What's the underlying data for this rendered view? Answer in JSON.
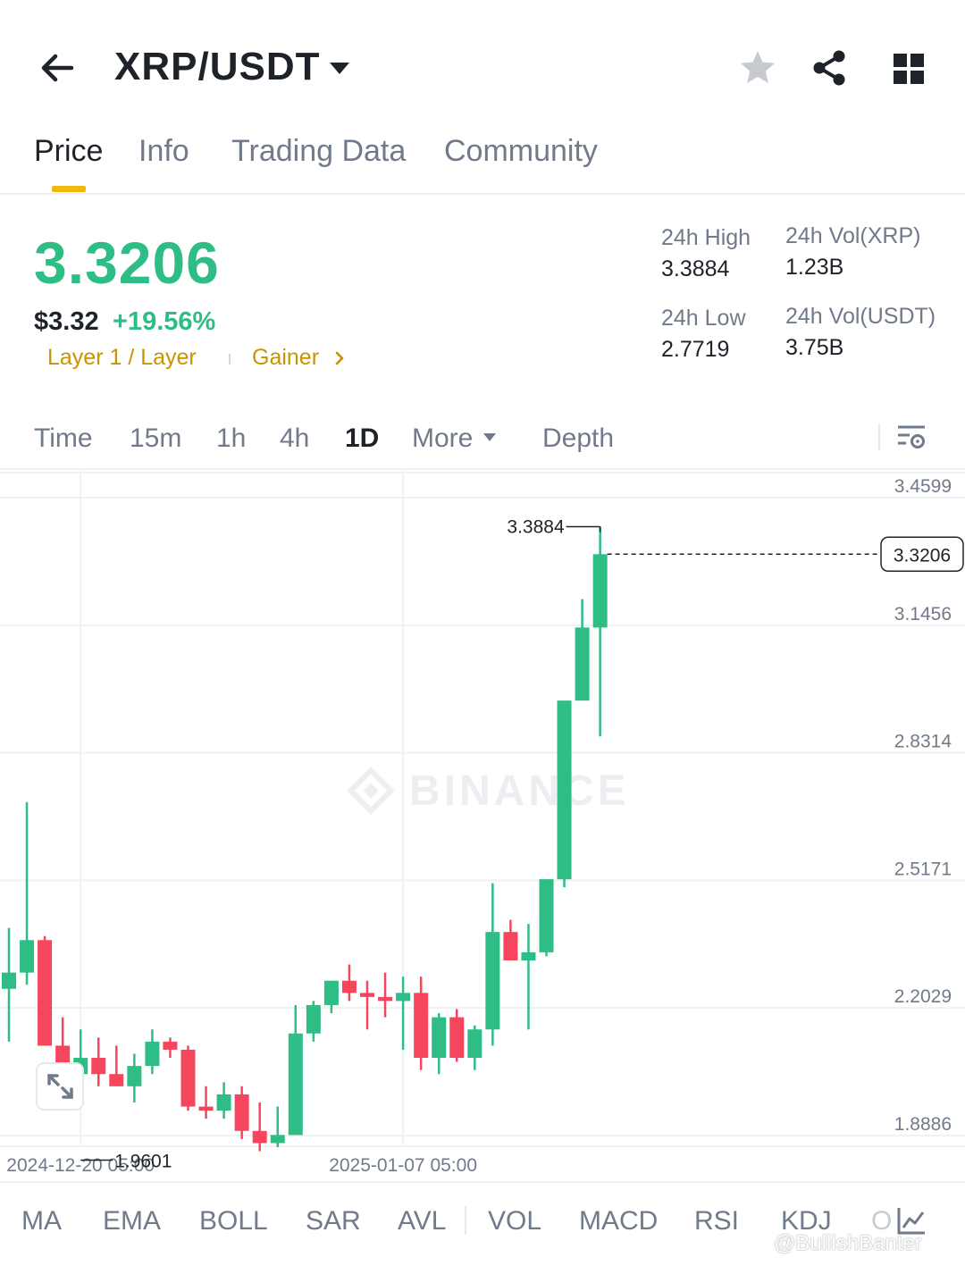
{
  "header": {
    "pair": "XRP/USDT",
    "icons": [
      "back-arrow-icon",
      "caret-down-icon",
      "star-icon",
      "share-icon",
      "grid-icon"
    ]
  },
  "tabs": [
    {
      "label": "Price",
      "active": true
    },
    {
      "label": "Info",
      "active": false
    },
    {
      "label": "Trading Data",
      "active": false
    },
    {
      "label": "Community",
      "active": false
    }
  ],
  "ticker": {
    "last_price": "3.3206",
    "usd_price": "$3.32",
    "change_pct": "+19.56%",
    "tag_category": "Layer 1 / Layer",
    "tag_gainer": "Gainer",
    "high_label": "24h High",
    "high_value": "3.3884",
    "low_label": "24h Low",
    "low_value": "2.7719",
    "vol_base_label": "24h Vol(XRP)",
    "vol_base_value": "1.23B",
    "vol_quote_label": "24h Vol(USDT)",
    "vol_quote_value": "3.75B"
  },
  "intervals": [
    {
      "label": "Time",
      "active": false
    },
    {
      "label": "15m",
      "active": false
    },
    {
      "label": "1h",
      "active": false
    },
    {
      "label": "4h",
      "active": false
    },
    {
      "label": "1D",
      "active": true
    },
    {
      "label": "More",
      "active": false
    },
    {
      "label": "Depth",
      "active": false
    }
  ],
  "chart_data": {
    "type": "candlestick",
    "ylim": [
      1.8886,
      3.4599
    ],
    "y_ticks": [
      "3.4599",
      "3.1456",
      "2.8314",
      "2.5171",
      "2.2029",
      "1.8886"
    ],
    "x_ticks": [
      "2024-12-20 05:00",
      "2025-01-07 05:00"
    ],
    "current_price_label": "3.3206",
    "high_marker": "3.3884",
    "low_marker": "1.9601",
    "watermark": "BINANCE",
    "colors": {
      "up": "#2ebd85",
      "down": "#f6465d",
      "grid": "#f0f1f2"
    },
    "candles": [
      {
        "o": 2.25,
        "h": 2.4,
        "l": 2.12,
        "c": 2.29
      },
      {
        "o": 2.29,
        "h": 2.71,
        "l": 2.26,
        "c": 2.37
      },
      {
        "o": 2.37,
        "h": 2.38,
        "l": 2.24,
        "c": 2.11
      },
      {
        "o": 2.11,
        "h": 2.18,
        "l": 2.01,
        "c": 2.04
      },
      {
        "o": 2.04,
        "h": 2.15,
        "l": 1.9601,
        "c": 2.08
      },
      {
        "o": 2.08,
        "h": 2.13,
        "l": 2.01,
        "c": 2.04
      },
      {
        "o": 2.04,
        "h": 2.11,
        "l": 2.01,
        "c": 2.01
      },
      {
        "o": 2.01,
        "h": 2.09,
        "l": 1.97,
        "c": 2.06
      },
      {
        "o": 2.06,
        "h": 2.15,
        "l": 2.04,
        "c": 2.12
      },
      {
        "o": 2.12,
        "h": 2.13,
        "l": 2.08,
        "c": 2.1
      },
      {
        "o": 2.1,
        "h": 2.11,
        "l": 1.95,
        "c": 1.96
      },
      {
        "o": 1.96,
        "h": 2.01,
        "l": 1.93,
        "c": 1.95
      },
      {
        "o": 1.95,
        "h": 2.02,
        "l": 1.93,
        "c": 1.99
      },
      {
        "o": 1.99,
        "h": 2.01,
        "l": 1.88,
        "c": 1.9
      },
      {
        "o": 1.9,
        "h": 1.97,
        "l": 1.85,
        "c": 1.87
      },
      {
        "o": 1.87,
        "h": 1.96,
        "l": 1.86,
        "c": 1.89
      },
      {
        "o": 1.89,
        "h": 2.21,
        "l": 1.89,
        "c": 2.14
      },
      {
        "o": 2.14,
        "h": 2.22,
        "l": 2.12,
        "c": 2.21
      },
      {
        "o": 2.21,
        "h": 2.27,
        "l": 2.19,
        "c": 2.27
      },
      {
        "o": 2.27,
        "h": 2.31,
        "l": 2.22,
        "c": 2.24
      },
      {
        "o": 2.24,
        "h": 2.27,
        "l": 2.15,
        "c": 2.23
      },
      {
        "o": 2.23,
        "h": 2.29,
        "l": 2.18,
        "c": 2.22
      },
      {
        "o": 2.22,
        "h": 2.28,
        "l": 2.1,
        "c": 2.24
      },
      {
        "o": 2.24,
        "h": 2.28,
        "l": 2.05,
        "c": 2.08
      },
      {
        "o": 2.08,
        "h": 2.19,
        "l": 2.04,
        "c": 2.18
      },
      {
        "o": 2.18,
        "h": 2.2,
        "l": 2.07,
        "c": 2.08
      },
      {
        "o": 2.08,
        "h": 2.16,
        "l": 2.05,
        "c": 2.15
      },
      {
        "o": 2.15,
        "h": 2.51,
        "l": 2.11,
        "c": 2.39
      },
      {
        "o": 2.39,
        "h": 2.42,
        "l": 2.33,
        "c": 2.32
      },
      {
        "o": 2.32,
        "h": 2.41,
        "l": 2.15,
        "c": 2.34
      },
      {
        "o": 2.34,
        "h": 2.52,
        "l": 2.33,
        "c": 2.52
      },
      {
        "o": 2.52,
        "h": 2.95,
        "l": 2.5,
        "c": 2.96
      },
      {
        "o": 2.96,
        "h": 3.21,
        "l": 2.96,
        "c": 3.14
      },
      {
        "o": 3.14,
        "h": 3.3884,
        "l": 2.8719,
        "c": 3.3206
      }
    ]
  },
  "indicators": [
    {
      "label": "MA"
    },
    {
      "label": "EMA"
    },
    {
      "label": "BOLL"
    },
    {
      "label": "SAR"
    },
    {
      "label": "AVL"
    },
    {
      "label": "VOL"
    },
    {
      "label": "MACD"
    },
    {
      "label": "RSI"
    },
    {
      "label": "KDJ"
    },
    {
      "label": "O"
    }
  ],
  "watermark_user": "@BullishBanter"
}
